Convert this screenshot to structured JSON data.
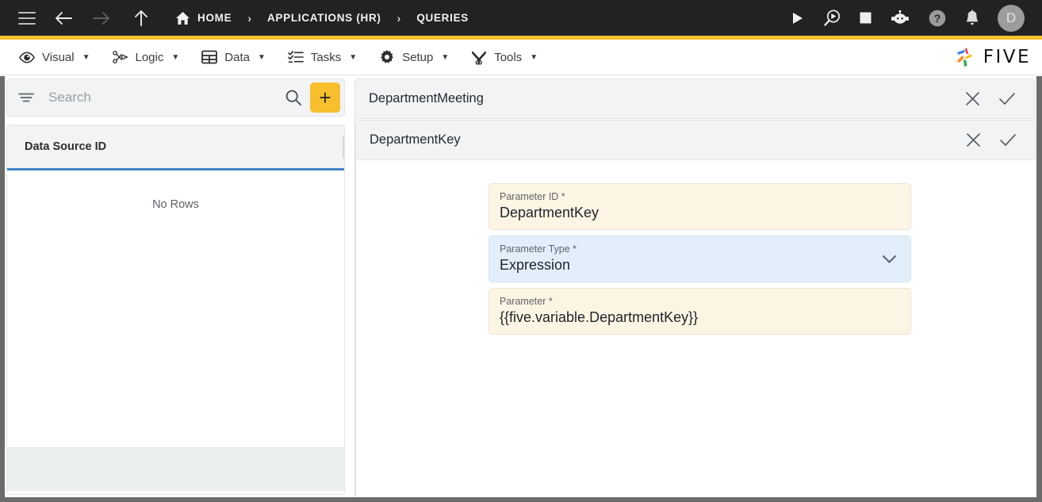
{
  "topbar": {
    "menu_icon": "hamburger-icon",
    "back_icon": "arrow-left-icon",
    "forward_icon": "arrow-right-icon",
    "up_icon": "arrow-up-icon",
    "breadcrumbs": [
      {
        "label": "HOME",
        "icon": "home-icon"
      },
      {
        "label": "APPLICATIONS (HR)",
        "icon": ""
      },
      {
        "label": "QUERIES",
        "icon": ""
      }
    ],
    "separator": "›",
    "actions": [
      {
        "name": "run-icon",
        "title": "Run"
      },
      {
        "name": "debug-icon",
        "title": "Debug"
      },
      {
        "name": "stop-icon",
        "title": "Stop"
      },
      {
        "name": "assistant-bot-icon",
        "title": "Assistant"
      },
      {
        "name": "help-icon",
        "title": "Help"
      },
      {
        "name": "notifications-bell-icon",
        "title": "Notifications"
      }
    ],
    "avatar_initial": "D",
    "background": "#222222",
    "accent_rule": "#f7c12e"
  },
  "menubar": {
    "items": [
      {
        "label": "Visual",
        "icon": "eye-icon",
        "caret": "▼"
      },
      {
        "label": "Logic",
        "icon": "logic-nodes-icon",
        "caret": "▼"
      },
      {
        "label": "Data",
        "icon": "table-grid-icon",
        "caret": "▼"
      },
      {
        "label": "Tasks",
        "icon": "checklist-icon",
        "caret": "▼"
      },
      {
        "label": "Setup",
        "icon": "gear-icon",
        "caret": "▼"
      },
      {
        "label": "Tools",
        "icon": "tools-icon",
        "caret": "▼"
      }
    ],
    "brand": "FIVE"
  },
  "sidebar": {
    "search": {
      "value": "",
      "placeholder": "Search",
      "filter_icon": "filter-icon",
      "search_icon": "search-icon"
    },
    "add_button_label": "+",
    "grid": {
      "columns": [
        "Data Source ID"
      ],
      "rows": [],
      "empty_text": "No Rows"
    },
    "accent_underline": "#4285c5",
    "add_button_color": "#f7bf2e"
  },
  "main": {
    "panels": [
      {
        "title": "DepartmentMeeting",
        "close_icon": "close-icon",
        "confirm_icon": "check-icon"
      },
      {
        "title": "DepartmentKey",
        "close_icon": "close-icon",
        "confirm_icon": "check-icon"
      }
    ],
    "form": {
      "fields": [
        {
          "label": "Parameter ID *",
          "value": "DepartmentKey",
          "type": "text",
          "style": "cream"
        },
        {
          "label": "Parameter Type *",
          "value": "Expression",
          "type": "select",
          "style": "blue",
          "chevron": "chevron-down-icon"
        },
        {
          "label": "Parameter *",
          "value": "{{five.variable.DepartmentKey}}",
          "type": "text",
          "style": "cream"
        }
      ]
    }
  }
}
